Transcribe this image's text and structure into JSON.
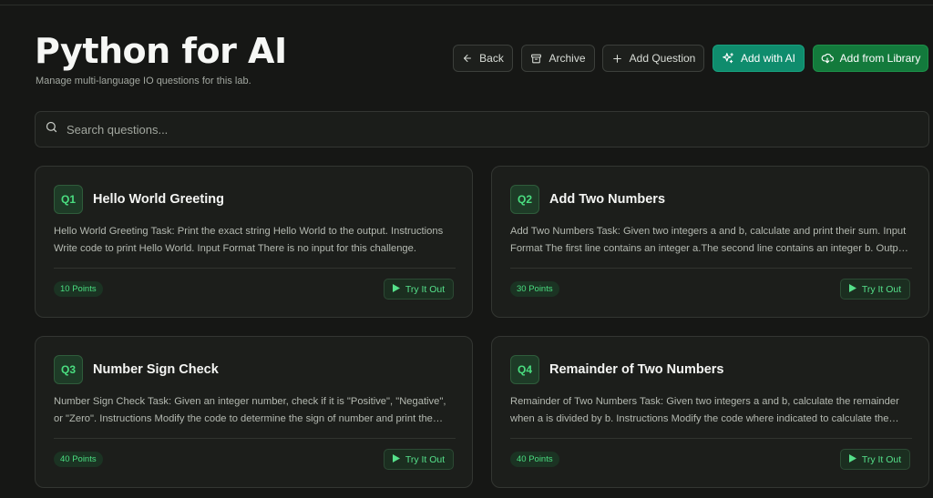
{
  "header": {
    "title": "Python for AI",
    "subtitle": "Manage multi-language IO questions for this lab."
  },
  "toolbar": {
    "back_label": "Back",
    "archive_label": "Archive",
    "add_question_label": "Add Question",
    "add_ai_label": "Add with AI",
    "add_library_label": "Add from Library"
  },
  "search": {
    "placeholder": "Search questions..."
  },
  "questions": [
    {
      "badge": "Q1",
      "title": "Hello World Greeting",
      "description": "Hello World Greeting Task: Print the exact string Hello World to the output. Instructions Write code to print Hello World. Input Format There is no input for this challenge.",
      "points": "10 Points",
      "try_label": "Try It Out"
    },
    {
      "badge": "Q2",
      "title": "Add Two Numbers",
      "description": "Add Two Numbers Task: Given two integers a and b, calculate and print their sum. Input Format The first line contains an integer a.The second line contains an integer b. Output Format",
      "points": "30 Points",
      "try_label": "Try It Out"
    },
    {
      "badge": "Q3",
      "title": "Number Sign Check",
      "description": "Number Sign Check Task: Given an integer number, check if it is \"Positive\", \"Negative\", or \"Zero\". Instructions Modify the code to determine the sign of number and print the result.",
      "points": "40 Points",
      "try_label": "Try It Out"
    },
    {
      "badge": "Q4",
      "title": "Remainder of Two Numbers",
      "description": "Remainder of Two Numbers Task: Given two integers a and b, calculate the remainder when a is divided by b. Instructions Modify the code where indicated to calculate the remainder.",
      "points": "40 Points",
      "try_label": "Try It Out"
    }
  ],
  "icons": {
    "back": "arrow-left-icon",
    "archive": "archive-icon",
    "add": "plus-icon",
    "ai": "sparkles-icon",
    "library": "cloud-download-icon",
    "search": "search-icon",
    "try": "play-icon"
  },
  "colors": {
    "accent_green": "#4ade80",
    "ai_button": "#0f8c6d",
    "library_button": "#137a3c",
    "background": "#161715",
    "card": "#1c1e1b"
  }
}
